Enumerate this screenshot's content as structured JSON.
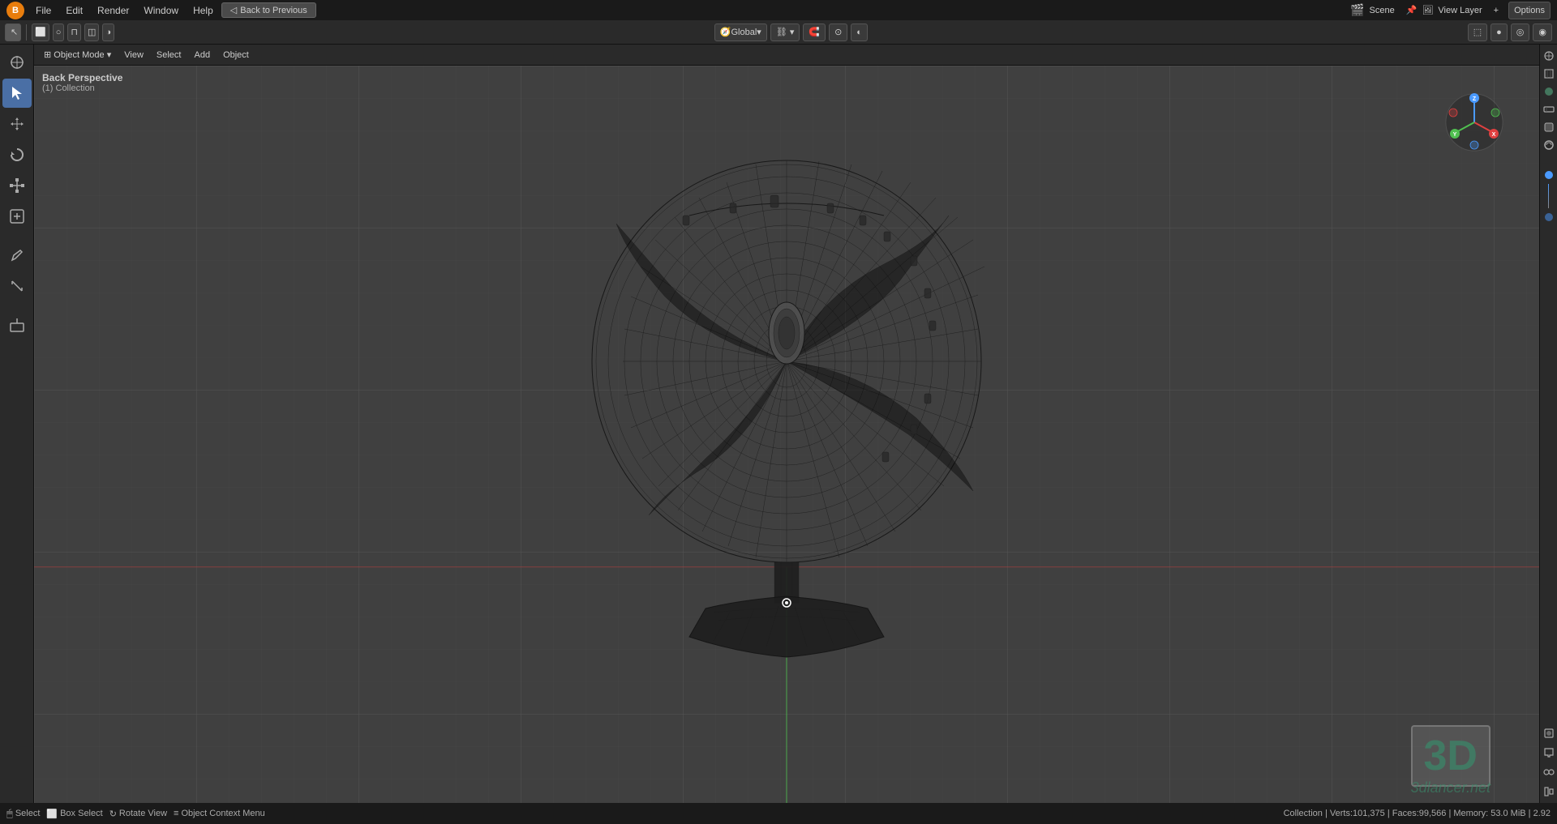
{
  "app": {
    "logo": "B",
    "title": "Blender",
    "back_to_previous": "Back to Previous",
    "scene_label": "Scene",
    "view_layer_label": "View Layer",
    "options_label": "Options"
  },
  "top_menu": {
    "items": [
      "File",
      "Edit",
      "Render",
      "Window",
      "Help"
    ]
  },
  "toolbar": {
    "mode_selector": "Object Mode",
    "viewport_shading": "Global",
    "center_items": [
      "◯",
      "⛓",
      "⊞",
      "⊙",
      "◐"
    ],
    "snap_items": [
      "⊙",
      "↺"
    ]
  },
  "viewport_header": {
    "items": [
      "Object Mode",
      "View",
      "Select",
      "Add",
      "Object"
    ]
  },
  "viewport_info": {
    "view_name": "Back Perspective",
    "collection": "(1) Collection"
  },
  "status_bar": {
    "select_label": "Select",
    "box_select_label": "Box Select",
    "rotate_view_label": "Rotate View",
    "object_context_menu_label": "Object Context Menu",
    "stats": "Collection | Verts:101,375 | Faces:99,566 | Memory: 53.0 MiB | 2.92"
  },
  "watermark": {
    "text_3d": "3D",
    "site": "3dlancer.net"
  },
  "left_tools": [
    {
      "name": "cursor-tool",
      "icon": "✛",
      "active": false
    },
    {
      "name": "select-tool",
      "icon": "↖",
      "active": true
    },
    {
      "name": "move-tool",
      "icon": "✥",
      "active": false
    },
    {
      "name": "rotate-tool",
      "icon": "↻",
      "active": false
    },
    {
      "name": "scale-tool",
      "icon": "⤡",
      "active": false
    },
    {
      "name": "transform-tool",
      "icon": "⊞",
      "active": false
    },
    {
      "name": "annotate-tool",
      "icon": "✏",
      "active": false
    },
    {
      "name": "measure-tool",
      "icon": "📐",
      "active": false
    },
    {
      "name": "add-primitive",
      "icon": "⊕",
      "active": false
    }
  ],
  "colors": {
    "background": "#404040",
    "toolbar_bg": "#2a2a2a",
    "topbar_bg": "#1a1a1a",
    "accent_blue": "#4a6fa5",
    "grid_color": "rgba(255,255,255,0.05)",
    "horizon_red": "rgba(200,60,60,0.6)",
    "y_axis_green": "rgba(80,180,80,0.7)"
  }
}
